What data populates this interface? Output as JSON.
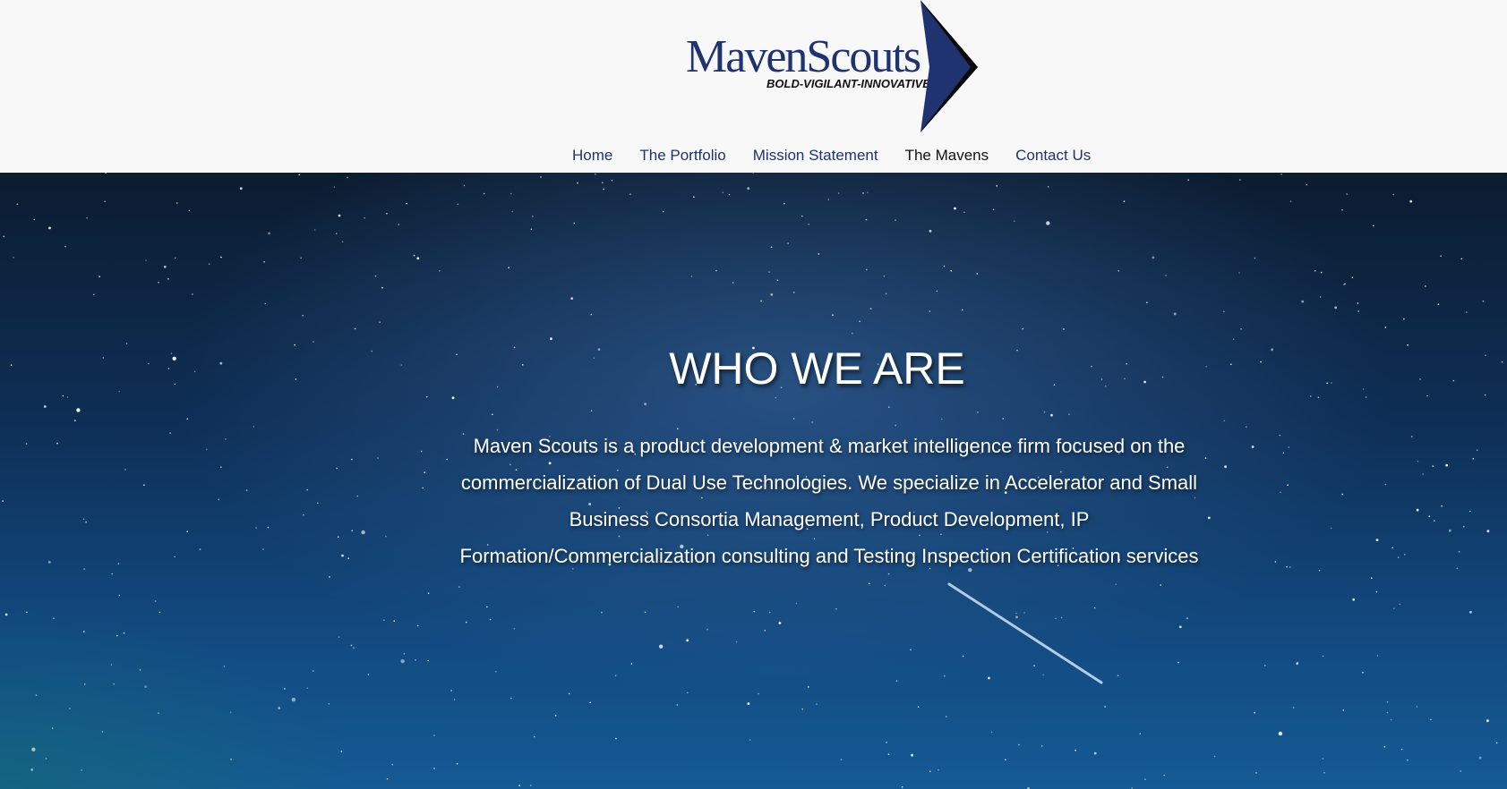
{
  "brand": {
    "logo_text": "MavenScouts",
    "tagline": "BOLD-VIGILANT-INNOVATIVE",
    "primary_color": "#1e3370"
  },
  "nav": {
    "items": [
      {
        "label": "Home"
      },
      {
        "label": "The Portfolio"
      },
      {
        "label": "Mission Statement"
      },
      {
        "label": "The Mavens"
      },
      {
        "label": "Contact Us"
      }
    ],
    "active_item": "The Mavens"
  },
  "hero": {
    "title": "WHO WE ARE",
    "body": "Maven Scouts is a product development & market intelligence firm focused on the commercialization of Dual Use Technologies. We specialize in Accelerator and Small Business Consortia Management, Product Development, IP Formation/Commercialization consulting and Testing Inspection Certification services",
    "background": "starry-night-sky-image"
  }
}
